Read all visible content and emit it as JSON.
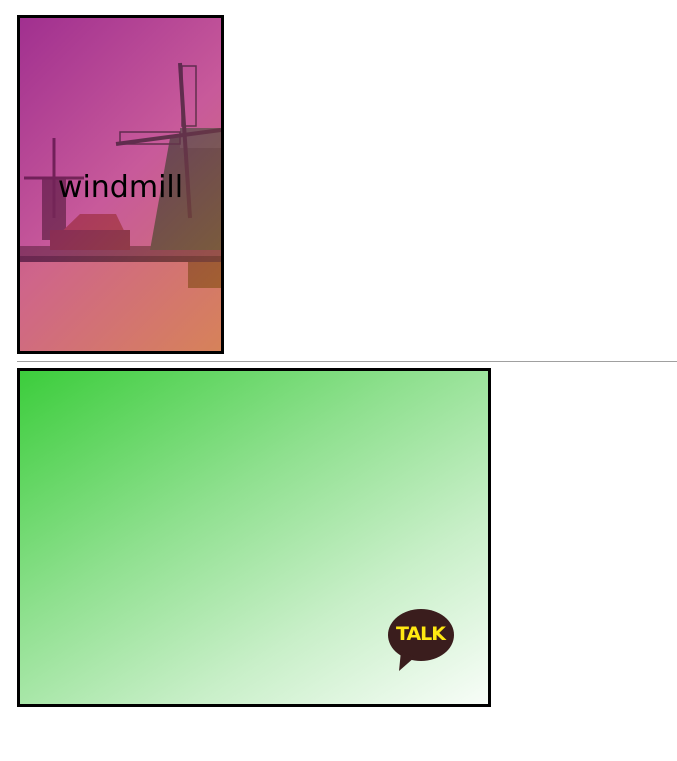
{
  "photo_card": {
    "caption": "windmill",
    "image": "windmill-scene"
  },
  "green_card": {
    "logo_text": "TALK",
    "colors": {
      "gradient_start": "#3ccd3c",
      "gradient_end": "#f8fdf8",
      "bubble": "#3a1d1d",
      "logo_text": "#ffe812"
    }
  }
}
